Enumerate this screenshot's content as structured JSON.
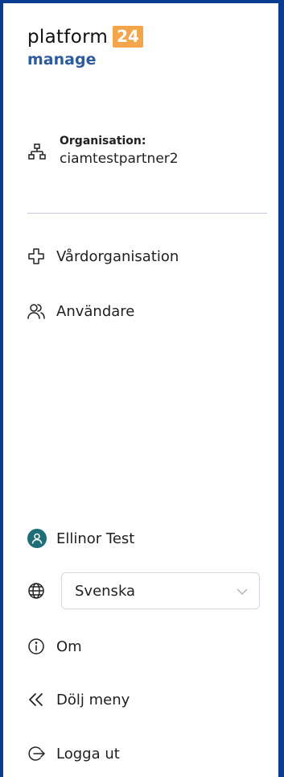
{
  "logo": {
    "wordmark": "platform",
    "badge": "24",
    "subtitle": "manage"
  },
  "organisation": {
    "label": "Organisation:",
    "value": "ciamtestpartner2"
  },
  "nav": {
    "items": [
      {
        "label": "Vårdorganisation",
        "icon": "cross-outline-icon"
      },
      {
        "label": "Användare",
        "icon": "users-icon"
      }
    ]
  },
  "user": {
    "name": "Ellinor Test"
  },
  "language": {
    "selected": "Svenska"
  },
  "footer": {
    "about": "Om",
    "hide_menu": "Dölj meny",
    "logout": "Logga ut"
  },
  "colors": {
    "border": "#0a3d91",
    "brand_orange": "#f3a54b",
    "brand_blue": "#2e5a9e",
    "avatar": "#1d6e76"
  }
}
